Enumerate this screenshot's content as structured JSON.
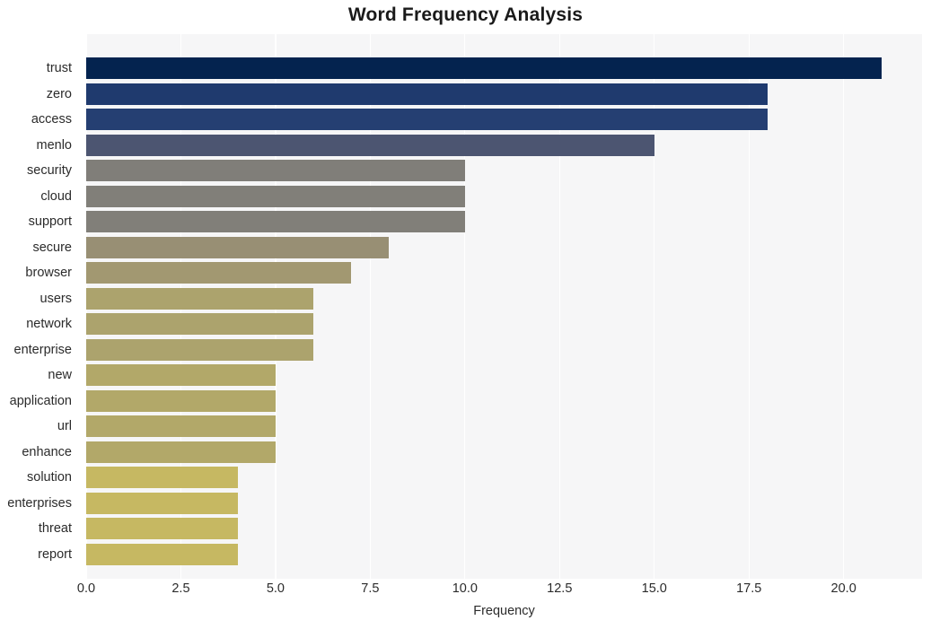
{
  "chart_data": {
    "type": "bar",
    "orientation": "horizontal",
    "title": "Word Frequency Analysis",
    "xlabel": "Frequency",
    "ylabel": "",
    "categories": [
      "trust",
      "zero",
      "access",
      "menlo",
      "security",
      "cloud",
      "support",
      "secure",
      "browser",
      "users",
      "network",
      "enterprise",
      "new",
      "application",
      "url",
      "enhance",
      "solution",
      "enterprises",
      "threat",
      "report"
    ],
    "values": [
      21,
      18,
      18,
      15,
      10,
      10,
      10,
      8,
      7,
      6,
      6,
      6,
      5,
      5,
      5,
      5,
      4,
      4,
      4,
      4
    ],
    "bar_colors": [
      "#04234f",
      "#1f3a6e",
      "#253f72",
      "#4c5571",
      "#807e79",
      "#817f79",
      "#817f79",
      "#988f74",
      "#a29871",
      "#aca36d",
      "#aca36d",
      "#aca36d",
      "#b2a869",
      "#b2a869",
      "#b2a869",
      "#b2a869",
      "#c6b862",
      "#c6b862",
      "#c6b862",
      "#c6b862"
    ],
    "xticks": [
      0.0,
      2.5,
      5.0,
      7.5,
      10.0,
      12.5,
      15.0,
      17.5,
      20.0
    ],
    "xtick_labels": [
      "0.0",
      "2.5",
      "5.0",
      "7.5",
      "10.0",
      "12.5",
      "15.0",
      "17.5",
      "20.0"
    ],
    "xlim": [
      0,
      22.07
    ],
    "grid": true,
    "grid_axis": "x",
    "grid_color": "#ffffff",
    "plot_background": "#f6f6f7",
    "figure_background": "#ffffff",
    "legend": null
  }
}
